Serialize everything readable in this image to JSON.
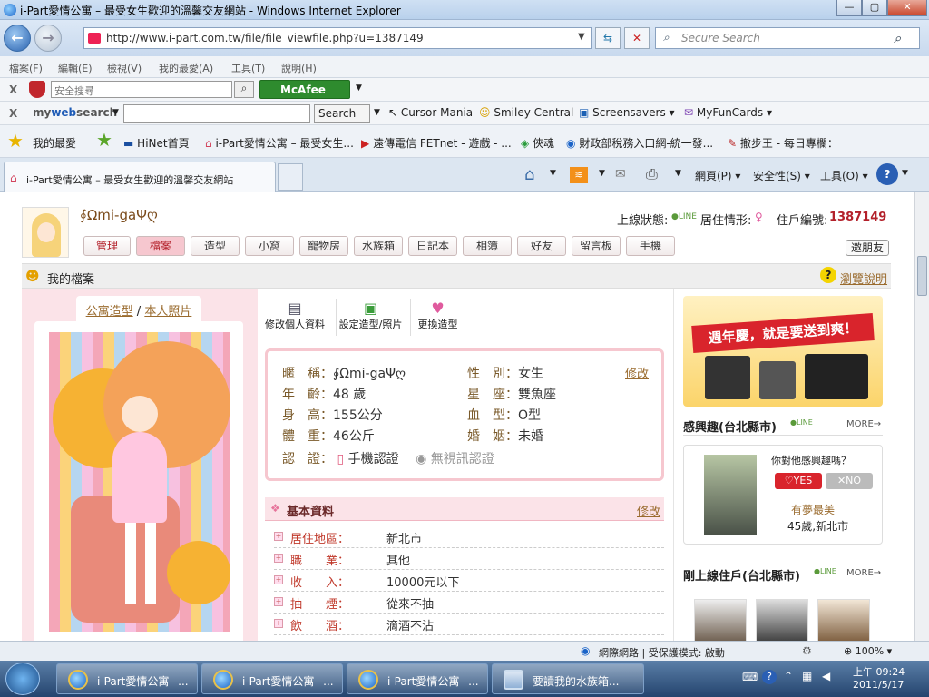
{
  "window": {
    "title": "i-Part愛情公寓 – 最受女生歡迎的溫馨交友網站 - Windows Internet Explorer",
    "min": "—",
    "max": "▢",
    "close": "✕"
  },
  "address": {
    "url": "http://www.i-part.com.tw/file/file_viewfile.php?u=1387149",
    "search_placeholder": "Secure Search"
  },
  "menus": [
    "檔案(F)",
    "編輯(E)",
    "檢視(V)",
    "我的最愛(A)",
    "工具(T)",
    "說明(H)"
  ],
  "toolbar1": {
    "search_placeholder": "安全搜尋",
    "mcafee": "McAfee"
  },
  "toolbar2": {
    "brand_my": "my",
    "brand_web": "web",
    "brand_search": "search",
    "search_btn": "Search",
    "links": [
      "Cursor Mania",
      "Smiley Central",
      "Screensavers",
      "MyFunCards"
    ]
  },
  "favbar": {
    "favorites": "我的最愛",
    "items": [
      "HiNet首頁",
      "i-Part愛情公寓 – 最受女生...",
      "遠傳電信 FETnet - 遊戲 - ...",
      "俠魂",
      "財政部稅務入口網-統一發...",
      "撤步王 - 每日專欄："
    ]
  },
  "tab": {
    "label": "i-Part愛情公寓 – 最受女生歡迎的溫馨交友網站"
  },
  "cmdbar": {
    "page": "網頁(P)",
    "safety": "安全性(S)",
    "tools": "工具(O)"
  },
  "profile": {
    "nickname": "∮Ωmi-gaΨღ",
    "online_label": "上線狀態:",
    "living_label": "居住情形:",
    "id_label": "住戶編號:",
    "id_value": "1387149",
    "nav": [
      "管理",
      "檔案",
      "造型",
      "小窩",
      "寵物房",
      "水族箱",
      "日記本",
      "相簿",
      "好友",
      "留言板",
      "手機"
    ],
    "invite": "邀朋友",
    "section_title": "我的檔案",
    "help": "瀏覽說明",
    "photo_tabs": {
      "avatar": "公寓造型",
      "sep": "/",
      "photo": "本人照片"
    },
    "actions": [
      "修改個人資料",
      "設定造型/照片",
      "更換造型"
    ],
    "card": {
      "edit": "修改",
      "left": [
        {
          "k": "暱　稱：",
          "v": "∮Ωmi-gaΨღ"
        },
        {
          "k": "年　齡：",
          "v": "48 歲"
        },
        {
          "k": "身　高：",
          "v": "155公分"
        },
        {
          "k": "體　重：",
          "v": "46公斤"
        }
      ],
      "right": [
        {
          "k": "性　別：",
          "v": "女生"
        },
        {
          "k": "星　座：",
          "v": "雙魚座"
        },
        {
          "k": "血　型：",
          "v": "O型"
        },
        {
          "k": "婚　姻：",
          "v": "未婚"
        }
      ],
      "cert_label": "認　證：",
      "cert1": "手機認證",
      "cert2": "無視訊認證"
    },
    "basic": {
      "title": "基本資料",
      "edit": "修改",
      "rows": [
        {
          "k": "居住地區：",
          "v": "新北市"
        },
        {
          "k": "職　　業：",
          "v": "其他"
        },
        {
          "k": "收　　入：",
          "v": "10000元以下"
        },
        {
          "k": "抽　　煙：",
          "v": "從來不抽"
        },
        {
          "k": "飲　　酒：",
          "v": "滴酒不沾"
        }
      ]
    }
  },
  "sidebar": {
    "banner": "週年慶，就是要送到爽！",
    "interest_title": "感興趣(台北縣市)",
    "more": "MORE",
    "question": "你對他感興趣嗎？",
    "yes": "YES",
    "no": "NO",
    "user_name": "有夢最美",
    "user_info": "45歲,新北市",
    "online_title": "剛上線住戶(台北縣市)"
  },
  "statusbar": {
    "zone": "網際網路 | 受保護模式: 啟動",
    "zoom": "100%"
  },
  "taskbar": {
    "tasks": [
      "i-Part愛情公寓 –...",
      "i-Part愛情公寓 –...",
      "i-Part愛情公寓 –...",
      "要讀我的水族箱..."
    ],
    "time": "上午 09:24",
    "date": "2011/5/17"
  },
  "colors": {
    "accent_pink": "#f6c7cf",
    "id_red": "#b3202a",
    "link_brown": "#9a6b2e"
  }
}
